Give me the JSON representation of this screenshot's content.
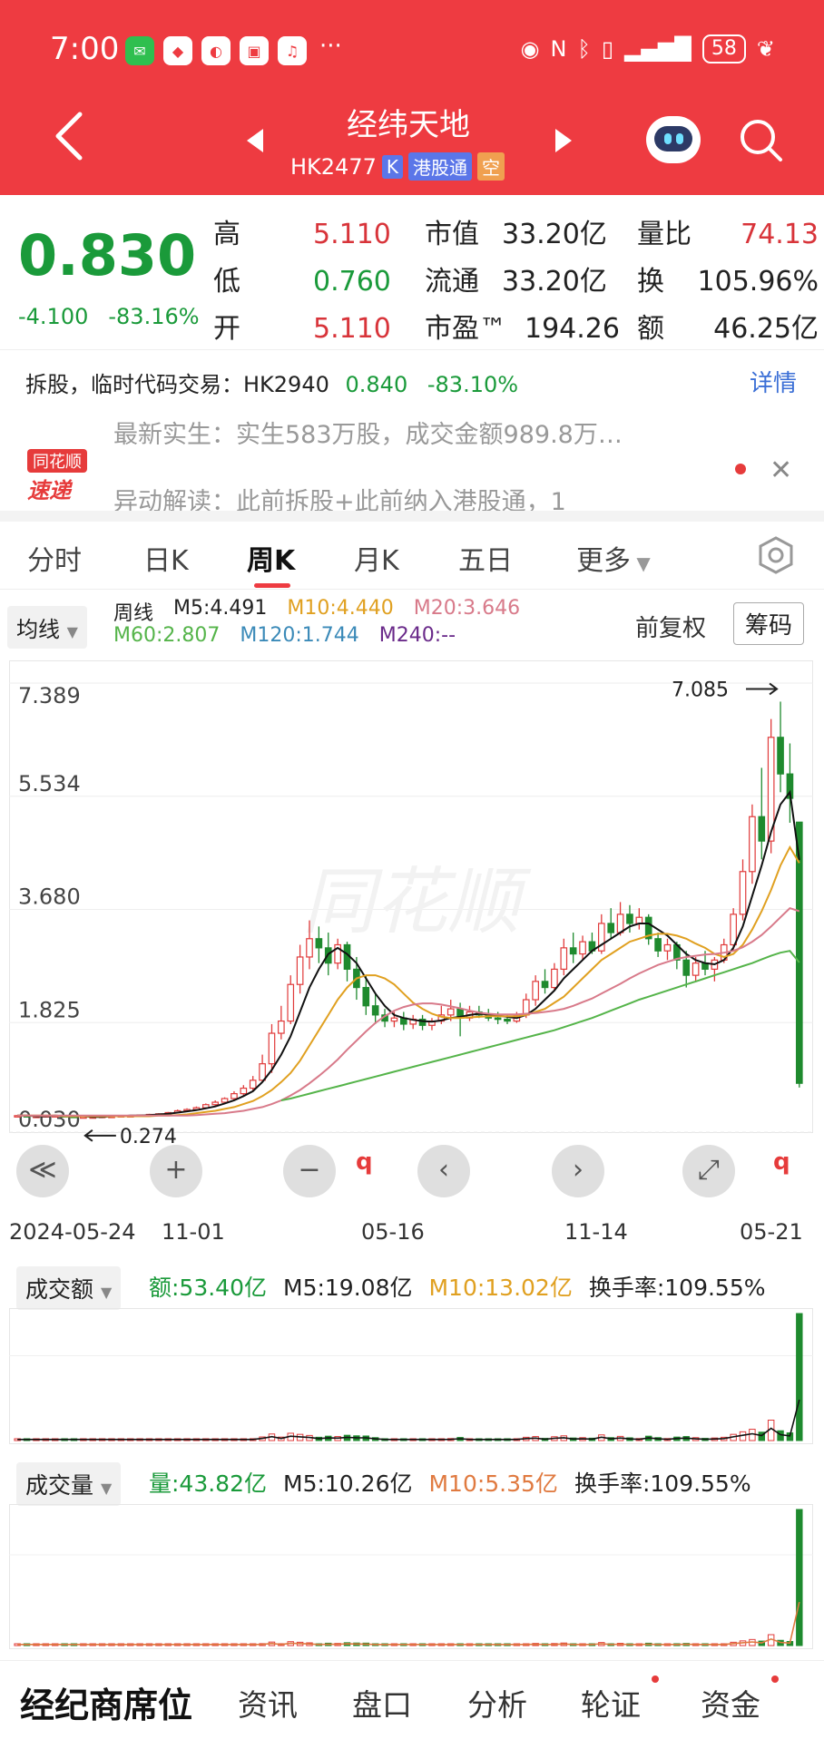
{
  "status_bar": {
    "time": "7:00",
    "more": "···",
    "battery": "58"
  },
  "header": {
    "stock_name": "经纬天地",
    "stock_code": "HK2477",
    "tag_k": "K",
    "tag_connect": "港股通",
    "tag_short": "空",
    "colors": {
      "bar": "#ee3b41"
    }
  },
  "quote": {
    "price": "0.830",
    "change": "-4.100",
    "change_pct": "-83.16%",
    "high_label": "高",
    "high": "5.110",
    "low_label": "低",
    "low": "0.760",
    "open_label": "开",
    "open": "5.110",
    "mktcap_label": "市值",
    "mktcap": "33.20亿",
    "float_label": "流通",
    "float": "33.20亿",
    "pe_label": "市盈™",
    "pe": "194.26",
    "vratio_label": "量比",
    "vratio": "74.13",
    "turnover_label": "换",
    "turnover": "105.96%",
    "amount_label": "额",
    "amount": "46.25亿"
  },
  "split": {
    "text": "拆股，临时代码交易：HK2940",
    "price": "0.840",
    "pct": "-83.10%",
    "detail": "详情"
  },
  "news": {
    "logo_top": "同花顺",
    "logo_bottom": "速递",
    "line1": "最新实生：实生583万股，成交金额989.8万…",
    "line2": "异动解读：此前拆股+此前纳入港股通，1"
  },
  "tabs": [
    "分时",
    "日K",
    "周K",
    "月K",
    "五日",
    "更多"
  ],
  "active_tab": 2,
  "ma": {
    "select": "均线",
    "period": "周线",
    "m5": "M5:4.491",
    "m10": "M10:4.440",
    "m20": "M20:3.646",
    "m60": "M60:2.807",
    "m120": "M120:1.744",
    "m240": "M240:--",
    "adjust": "前复权",
    "chips": "筹码"
  },
  "controls": [
    "≪",
    "+",
    "−",
    "‹",
    "›",
    "⤢"
  ],
  "q_mark": "q",
  "dates": [
    "2024-05-24",
    "11-01",
    "05-16",
    "11-14",
    "05-21"
  ],
  "chart_data": {
    "type": "candlestick",
    "y_ticks": [
      "7.389",
      "5.534",
      "3.680",
      "1.825",
      "0.030"
    ],
    "ylim": [
      0.03,
      7.389
    ],
    "max_label": "7.085",
    "min_label": "0.274",
    "watermark": "同花顺",
    "candles": [
      [
        0.3,
        0.31,
        0.29,
        0.3
      ],
      [
        0.3,
        0.31,
        0.28,
        0.29
      ],
      [
        0.29,
        0.3,
        0.28,
        0.29
      ],
      [
        0.29,
        0.3,
        0.28,
        0.3
      ],
      [
        0.3,
        0.31,
        0.29,
        0.3
      ],
      [
        0.3,
        0.3,
        0.28,
        0.29
      ],
      [
        0.29,
        0.3,
        0.28,
        0.28
      ],
      [
        0.28,
        0.29,
        0.27,
        0.28
      ],
      [
        0.28,
        0.29,
        0.27,
        0.28
      ],
      [
        0.28,
        0.29,
        0.274,
        0.29
      ],
      [
        0.29,
        0.3,
        0.28,
        0.29
      ],
      [
        0.29,
        0.31,
        0.28,
        0.3
      ],
      [
        0.3,
        0.31,
        0.29,
        0.3
      ],
      [
        0.3,
        0.32,
        0.29,
        0.31
      ],
      [
        0.31,
        0.33,
        0.3,
        0.32
      ],
      [
        0.32,
        0.34,
        0.31,
        0.33
      ],
      [
        0.33,
        0.36,
        0.32,
        0.35
      ],
      [
        0.35,
        0.4,
        0.34,
        0.38
      ],
      [
        0.38,
        0.42,
        0.36,
        0.4
      ],
      [
        0.4,
        0.45,
        0.38,
        0.43
      ],
      [
        0.43,
        0.5,
        0.42,
        0.48
      ],
      [
        0.48,
        0.55,
        0.45,
        0.52
      ],
      [
        0.52,
        0.6,
        0.5,
        0.58
      ],
      [
        0.58,
        0.7,
        0.55,
        0.66
      ],
      [
        0.66,
        0.8,
        0.62,
        0.75
      ],
      [
        0.75,
        0.95,
        0.7,
        0.88
      ],
      [
        0.88,
        1.3,
        0.85,
        1.15
      ],
      [
        1.15,
        1.8,
        1.0,
        1.65
      ],
      [
        1.65,
        2.1,
        1.55,
        1.85
      ],
      [
        1.85,
        2.6,
        1.8,
        2.45
      ],
      [
        2.45,
        3.1,
        2.3,
        2.9
      ],
      [
        2.9,
        3.5,
        2.7,
        3.2
      ],
      [
        3.2,
        3.4,
        2.8,
        3.05
      ],
      [
        3.05,
        3.3,
        2.6,
        2.8
      ],
      [
        2.8,
        3.2,
        2.7,
        3.1
      ],
      [
        3.1,
        3.15,
        2.5,
        2.7
      ],
      [
        2.7,
        2.9,
        2.2,
        2.4
      ],
      [
        2.4,
        2.6,
        1.95,
        2.1
      ],
      [
        2.1,
        2.3,
        1.8,
        1.95
      ],
      [
        1.95,
        2.05,
        1.75,
        1.85
      ],
      [
        1.85,
        2.0,
        1.75,
        1.9
      ],
      [
        1.9,
        2.0,
        1.7,
        1.8
      ],
      [
        1.8,
        1.95,
        1.72,
        1.88
      ],
      [
        1.88,
        1.95,
        1.7,
        1.78
      ],
      [
        1.78,
        1.9,
        1.7,
        1.85
      ],
      [
        1.85,
        2.1,
        1.8,
        1.95
      ],
      [
        1.95,
        2.2,
        1.85,
        2.05
      ],
      [
        2.05,
        2.15,
        1.6,
        1.9
      ],
      [
        1.9,
        2.1,
        1.85,
        2.0
      ],
      [
        2.0,
        2.1,
        1.9,
        1.95
      ],
      [
        1.95,
        2.05,
        1.85,
        1.9
      ],
      [
        1.9,
        2.0,
        1.8,
        1.88
      ],
      [
        1.88,
        1.95,
        1.8,
        1.85
      ],
      [
        1.85,
        2.0,
        1.82,
        1.95
      ],
      [
        1.95,
        2.3,
        1.9,
        2.2
      ],
      [
        2.2,
        2.6,
        2.1,
        2.5
      ],
      [
        2.5,
        2.7,
        2.3,
        2.4
      ],
      [
        2.4,
        2.8,
        2.35,
        2.7
      ],
      [
        2.7,
        3.2,
        2.6,
        3.05
      ],
      [
        3.05,
        3.3,
        2.8,
        2.95
      ],
      [
        2.95,
        3.25,
        2.85,
        3.15
      ],
      [
        3.15,
        3.3,
        2.95,
        3.0
      ],
      [
        3.0,
        3.6,
        2.95,
        3.45
      ],
      [
        3.45,
        3.7,
        3.2,
        3.3
      ],
      [
        3.3,
        3.8,
        3.25,
        3.6
      ],
      [
        3.6,
        3.75,
        3.3,
        3.45
      ],
      [
        3.45,
        3.7,
        3.35,
        3.55
      ],
      [
        3.55,
        3.6,
        3.1,
        3.2
      ],
      [
        3.2,
        3.3,
        2.9,
        3.0
      ],
      [
        3.0,
        3.2,
        2.85,
        3.1
      ],
      [
        3.1,
        3.15,
        2.7,
        2.85
      ],
      [
        2.85,
        3.0,
        2.4,
        2.6
      ],
      [
        2.6,
        2.9,
        2.5,
        2.8
      ],
      [
        2.8,
        3.0,
        2.6,
        2.7
      ],
      [
        2.7,
        2.9,
        2.5,
        2.85
      ],
      [
        2.85,
        3.2,
        2.8,
        3.1
      ],
      [
        3.1,
        3.7,
        3.0,
        3.6
      ],
      [
        3.6,
        4.5,
        3.5,
        4.3
      ],
      [
        4.3,
        5.4,
        4.1,
        5.2
      ],
      [
        5.2,
        6.0,
        4.5,
        4.8
      ],
      [
        4.8,
        6.8,
        4.6,
        6.5
      ],
      [
        6.5,
        7.085,
        5.6,
        5.9
      ],
      [
        5.9,
        6.4,
        5.1,
        5.5
      ],
      [
        5.11,
        5.11,
        0.76,
        0.83
      ]
    ],
    "ma_series": [
      {
        "name": "M5",
        "color": "#111111",
        "values": [
          0.3,
          0.3,
          0.29,
          0.29,
          0.3,
          0.29,
          0.29,
          0.29,
          0.28,
          0.28,
          0.29,
          0.29,
          0.3,
          0.3,
          0.31,
          0.32,
          0.33,
          0.35,
          0.37,
          0.39,
          0.42,
          0.45,
          0.5,
          0.55,
          0.62,
          0.7,
          0.85,
          1.05,
          1.3,
          1.6,
          2.0,
          2.4,
          2.7,
          2.95,
          3.05,
          2.95,
          2.8,
          2.55,
          2.3,
          2.1,
          1.95,
          1.9,
          1.87,
          1.85,
          1.84,
          1.86,
          1.9,
          1.92,
          1.95,
          1.97,
          1.96,
          1.94,
          1.92,
          1.9,
          1.95,
          2.05,
          2.2,
          2.35,
          2.55,
          2.7,
          2.85,
          3.0,
          3.1,
          3.2,
          3.3,
          3.4,
          3.45,
          3.45,
          3.35,
          3.25,
          3.1,
          2.95,
          2.85,
          2.8,
          2.78,
          2.85,
          3.05,
          3.4,
          3.9,
          4.4,
          4.95,
          5.4,
          5.6,
          4.49
        ]
      },
      {
        "name": "M10",
        "color": "#e0a020",
        "values": [
          0.3,
          0.3,
          0.3,
          0.3,
          0.3,
          0.29,
          0.29,
          0.29,
          0.29,
          0.29,
          0.29,
          0.29,
          0.29,
          0.29,
          0.29,
          0.3,
          0.3,
          0.31,
          0.32,
          0.34,
          0.36,
          0.38,
          0.41,
          0.44,
          0.49,
          0.54,
          0.62,
          0.72,
          0.85,
          1.0,
          1.2,
          1.45,
          1.7,
          1.95,
          2.2,
          2.4,
          2.55,
          2.6,
          2.6,
          2.55,
          2.45,
          2.3,
          2.15,
          2.05,
          1.97,
          1.92,
          1.9,
          1.9,
          1.91,
          1.92,
          1.93,
          1.93,
          1.93,
          1.93,
          1.95,
          2.0,
          2.05,
          2.15,
          2.25,
          2.4,
          2.55,
          2.7,
          2.85,
          2.95,
          3.05,
          3.15,
          3.2,
          3.25,
          3.28,
          3.28,
          3.25,
          3.2,
          3.12,
          3.05,
          2.95,
          2.9,
          2.95,
          3.1,
          3.35,
          3.65,
          4.0,
          4.4,
          4.7,
          4.44
        ]
      },
      {
        "name": "M20",
        "color": "#d87a8a",
        "values": [
          0.3,
          0.3,
          0.3,
          0.3,
          0.3,
          0.3,
          0.3,
          0.3,
          0.3,
          0.3,
          0.3,
          0.3,
          0.3,
          0.3,
          0.3,
          0.3,
          0.3,
          0.3,
          0.3,
          0.31,
          0.32,
          0.33,
          0.34,
          0.36,
          0.38,
          0.41,
          0.44,
          0.49,
          0.55,
          0.63,
          0.72,
          0.83,
          0.95,
          1.08,
          1.22,
          1.38,
          1.53,
          1.68,
          1.82,
          1.93,
          2.02,
          2.08,
          2.12,
          2.14,
          2.14,
          2.12,
          2.09,
          2.06,
          2.02,
          1.99,
          1.97,
          1.96,
          1.96,
          1.96,
          1.97,
          1.98,
          2.0,
          2.02,
          2.05,
          2.1,
          2.16,
          2.22,
          2.3,
          2.38,
          2.46,
          2.55,
          2.63,
          2.7,
          2.77,
          2.82,
          2.87,
          2.9,
          2.92,
          2.94,
          2.95,
          2.97,
          3.0,
          3.06,
          3.15,
          3.26,
          3.4,
          3.55,
          3.7,
          3.65
        ]
      },
      {
        "name": "M60",
        "color": "#55b44a",
        "values": [
          null,
          null,
          null,
          null,
          null,
          null,
          null,
          null,
          null,
          null,
          null,
          null,
          null,
          null,
          null,
          null,
          null,
          null,
          null,
          null,
          null,
          null,
          null,
          null,
          null,
          null,
          null,
          null,
          0.55,
          0.58,
          0.62,
          0.66,
          0.7,
          0.74,
          0.78,
          0.82,
          0.86,
          0.9,
          0.94,
          0.98,
          1.02,
          1.06,
          1.1,
          1.14,
          1.18,
          1.22,
          1.26,
          1.3,
          1.34,
          1.38,
          1.42,
          1.46,
          1.5,
          1.54,
          1.58,
          1.62,
          1.66,
          1.7,
          1.75,
          1.8,
          1.85,
          1.9,
          1.96,
          2.02,
          2.08,
          2.14,
          2.2,
          2.25,
          2.3,
          2.35,
          2.4,
          2.45,
          2.5,
          2.55,
          2.6,
          2.65,
          2.7,
          2.75,
          2.8,
          2.86,
          2.92,
          2.97,
          3.0,
          2.81
        ]
      }
    ]
  },
  "amount_panel": {
    "select": "成交额",
    "value": "额:53.40亿",
    "m5": "M5:19.08亿",
    "m10": "M10:13.02亿",
    "turnover": "换手率:109.55%"
  },
  "volume_panel": {
    "select": "成交量",
    "value": "量:43.82亿",
    "m5": "M5:10.26亿",
    "m10": "M10:5.35亿",
    "turnover": "换手率:109.55%"
  },
  "bottom_nav": [
    "经纪商席位",
    "资讯",
    "盘口",
    "分析",
    "轮证",
    "资金"
  ]
}
